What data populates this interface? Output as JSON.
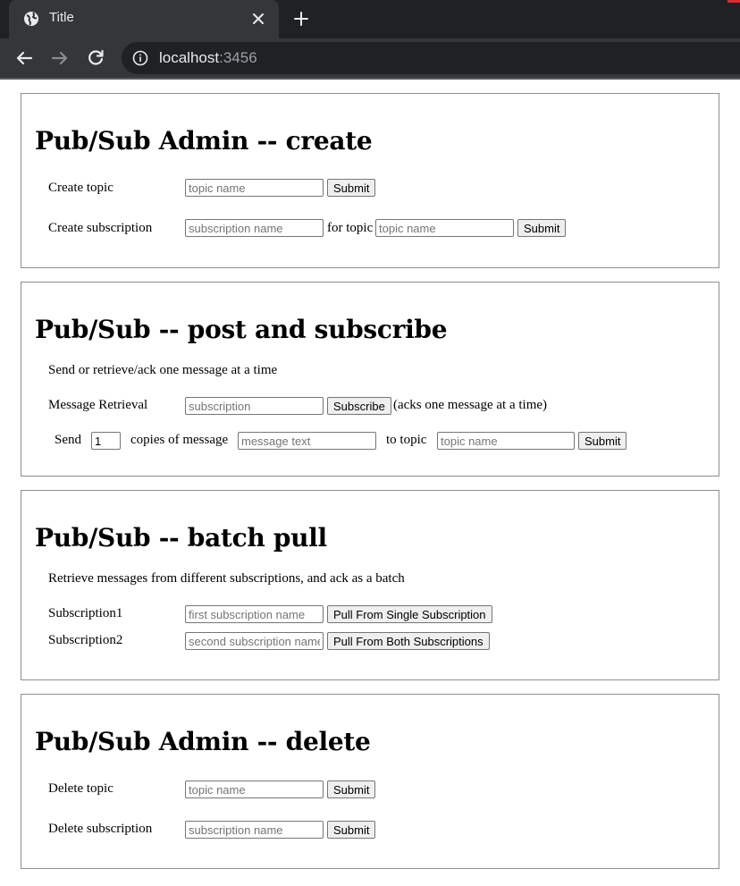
{
  "browser": {
    "tab_title": "Title",
    "url_host": "localhost",
    "url_port": ":3456"
  },
  "create": {
    "heading": "Pub/Sub Admin -- create",
    "topic_label": "Create topic",
    "topic_placeholder": "topic name",
    "topic_submit": "Submit",
    "sub_label": "Create subscription",
    "sub_placeholder": "subscription name",
    "for_topic": "for topic",
    "sub_topic_placeholder": "topic name",
    "sub_submit": "Submit"
  },
  "post": {
    "heading": "Pub/Sub -- post and subscribe",
    "description": "Send or retrieve/ack one message at a time",
    "retrieval_label": "Message Retrieval",
    "subscription_placeholder": "subscription",
    "subscribe_button": "Subscribe",
    "ack_note": "(acks one message at a time)",
    "send_label": "Send",
    "copies_value": "1",
    "copies_label": "copies of message",
    "message_placeholder": "message text",
    "to_topic": "to topic",
    "topic_placeholder": "topic name",
    "send_submit": "Submit"
  },
  "batch": {
    "heading": "Pub/Sub -- batch pull",
    "description": "Retrieve messages from different subscriptions, and ack as a batch",
    "sub1_label": "Subscription1",
    "sub1_placeholder": "first subscription name",
    "pull_single": "Pull From Single Subscription",
    "sub2_label": "Subscription2",
    "sub2_placeholder": "second subscription name",
    "pull_both": "Pull From Both Subscriptions"
  },
  "delete": {
    "heading": "Pub/Sub Admin -- delete",
    "topic_label": "Delete topic",
    "topic_placeholder": "topic name",
    "topic_submit": "Submit",
    "sub_label": "Delete subscription",
    "sub_placeholder": "subscription name",
    "sub_submit": "Submit"
  }
}
